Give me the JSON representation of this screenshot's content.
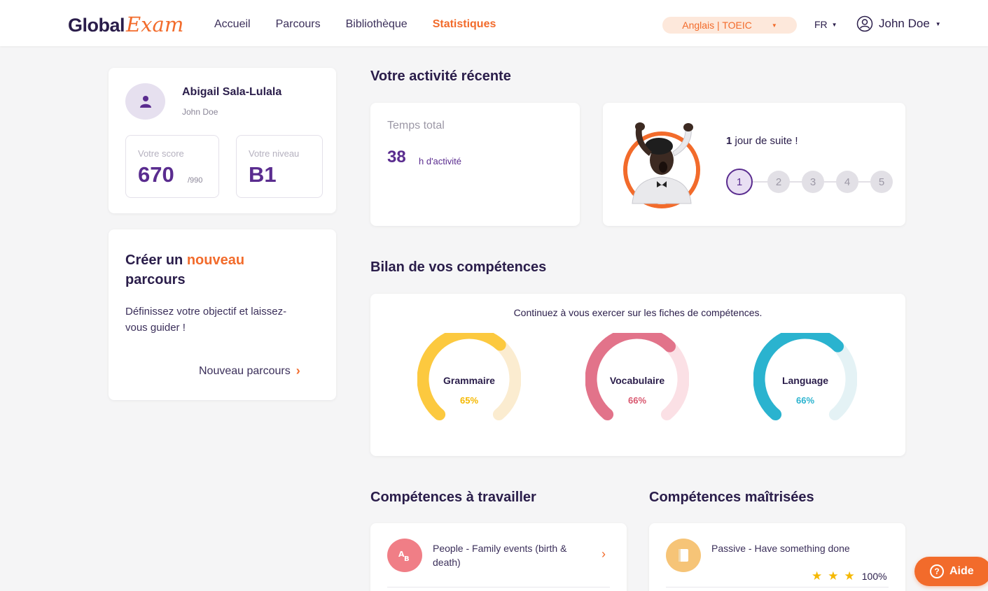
{
  "header": {
    "logo_part1": "Global",
    "logo_part2": "Exam",
    "nav": [
      "Accueil",
      "Parcours",
      "Bibliothèque",
      "Statistiques"
    ],
    "active_nav": "Statistiques",
    "language_select": "Anglais | TOEIC",
    "locale": "FR",
    "user_name": "John Doe"
  },
  "profile": {
    "name": "Abigail Sala-Lulala",
    "subtitle": "John Doe",
    "score_label": "Votre score",
    "score_value": "670",
    "score_max": "/990",
    "level_label": "Votre niveau",
    "level_value": "B1"
  },
  "new_path": {
    "title_part1": "Créer un ",
    "title_accent": "nouveau",
    "title_part2": " parcours",
    "description": "Définissez votre objectif et laissez-vous guider !",
    "link_label": "Nouveau parcours"
  },
  "activity": {
    "section_title": "Votre activité récente",
    "total_label": "Temps total",
    "total_value": "38",
    "total_unit": "h d'activité",
    "streak_count": "1",
    "streak_text": " jour de suite !",
    "streak_days": [
      "1",
      "2",
      "3",
      "4",
      "5"
    ],
    "streak_active_index": 0
  },
  "skills": {
    "section_title": "Bilan de vos compétences",
    "hint": "Continuez à vous exercer sur les fiches de compétences.",
    "gauges": [
      {
        "label": "Grammaire",
        "pct": "65%",
        "value": 65,
        "color": "#fcc93f",
        "track": "#fbecd0"
      },
      {
        "label": "Vocabulaire",
        "pct": "66%",
        "value": 66,
        "color": "#e2738a",
        "track": "#fbe0e5"
      },
      {
        "label": "Language",
        "pct": "66%",
        "value": 66,
        "color": "#2ab3cf",
        "track": "#e4f2f5"
      }
    ]
  },
  "to_work": {
    "section_title": "Compétences à travailler",
    "item_text": "People - Family events (birth & death)"
  },
  "mastered": {
    "section_title": "Compétences maîtrisées",
    "item_text": "Passive - Have something done",
    "stars": 3,
    "pct": "100%"
  },
  "help": {
    "label": "Aide"
  },
  "colors": {
    "accent": "#f26b2b",
    "brand": "#5a2c8f",
    "text": "#2a1d4a"
  }
}
